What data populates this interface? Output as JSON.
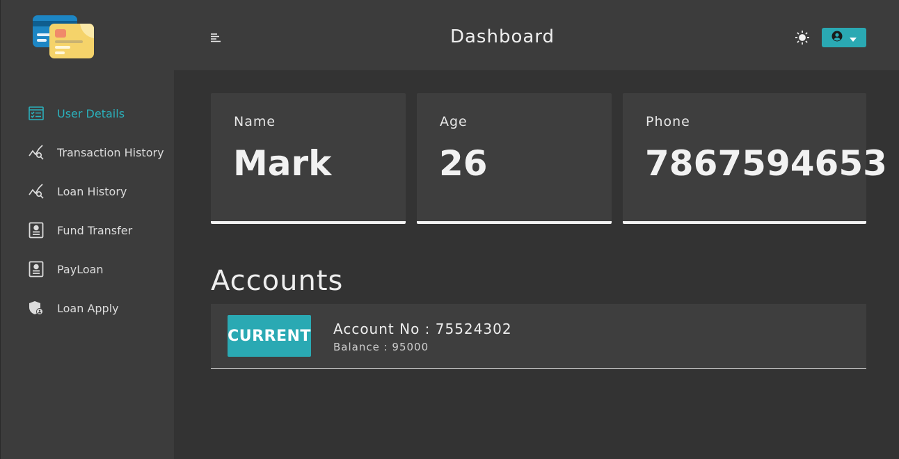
{
  "header": {
    "title": "Dashboard"
  },
  "sidebar": {
    "logo_icon": "credit-cards-logo",
    "items": [
      {
        "label": "User Details",
        "icon": "user-details-icon",
        "active": true
      },
      {
        "label": "Transaction History",
        "icon": "chart-search-icon",
        "active": false
      },
      {
        "label": "Loan History",
        "icon": "chart-search-icon",
        "active": false
      },
      {
        "label": "Fund Transfer",
        "icon": "contact-card-icon",
        "active": false
      },
      {
        "label": "PayLoan",
        "icon": "contact-card-icon",
        "active": false
      },
      {
        "label": "Loan Apply",
        "icon": "shield-user-icon",
        "active": false
      }
    ]
  },
  "user": {
    "name_label": "Name",
    "name": "Mark",
    "age_label": "Age",
    "age": "26",
    "phone_label": "Phone",
    "phone": "7867594653"
  },
  "accounts": {
    "title": "Accounts",
    "items": [
      {
        "type": "CURRENT",
        "number_text": "Account No : 75524302",
        "balance_text": "Balance : 95000"
      }
    ]
  },
  "colors": {
    "accent": "#2aa9b3",
    "background": "#333333",
    "panel": "#3c3c3c"
  }
}
